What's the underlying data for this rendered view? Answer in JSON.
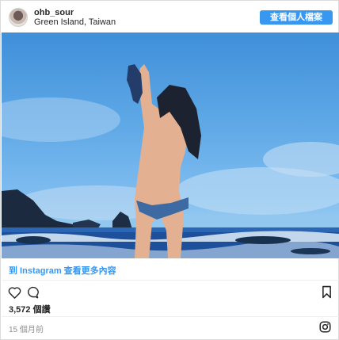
{
  "header": {
    "username": "ohb_sour",
    "location": "Green Island, Taiwan",
    "view_profile_label": "查看個人檔案"
  },
  "footer": {
    "more_link": "到 Instagram 查看更多內容",
    "likes": "3,572 個讚",
    "timestamp": "15 個月前"
  },
  "icons": {
    "like": "heart-outline-icon",
    "comment": "comment-bubble-icon",
    "save": "bookmark-icon",
    "brand": "instagram-logo-icon"
  },
  "colors": {
    "accent": "#3897f0",
    "text": "#262626",
    "muted": "#8e8e8e",
    "sky": "#5ea8e6",
    "sea": "#1d4f9a"
  }
}
